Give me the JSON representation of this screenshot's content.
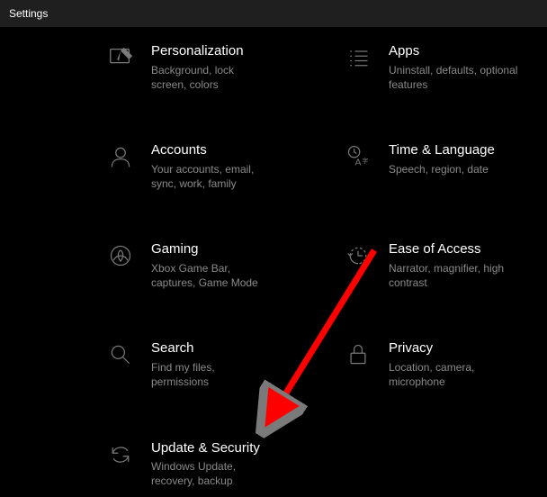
{
  "window": {
    "title": "Settings"
  },
  "tiles": {
    "personalization": {
      "title": "Personalization",
      "desc": "Background, lock screen, colors"
    },
    "apps": {
      "title": "Apps",
      "desc": "Uninstall, defaults, optional features"
    },
    "accounts": {
      "title": "Accounts",
      "desc": "Your accounts, email, sync, work, family"
    },
    "time": {
      "title": "Time & Language",
      "desc": "Speech, region, date"
    },
    "gaming": {
      "title": "Gaming",
      "desc": "Xbox Game Bar, captures, Game Mode"
    },
    "ease": {
      "title": "Ease of Access",
      "desc": "Narrator, magnifier, high contrast"
    },
    "search": {
      "title": "Search",
      "desc": "Find my files, permissions"
    },
    "privacy": {
      "title": "Privacy",
      "desc": "Location, camera, microphone"
    },
    "update": {
      "title": "Update & Security",
      "desc": "Windows Update, recovery, backup"
    }
  },
  "annotation": {
    "arrow_color": "#ff0000"
  }
}
